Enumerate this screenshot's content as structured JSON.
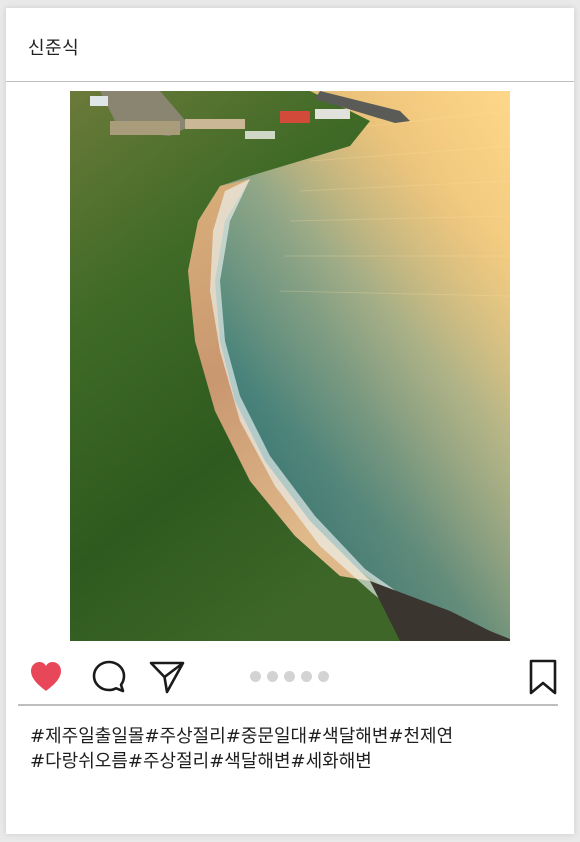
{
  "post": {
    "username": "신준식",
    "liked": true,
    "carousel_count": 5,
    "hashtags": [
      "#제주일출일몰#주상절리#중문일대#색달해변#천제연",
      "#다랑쉬오름#주상절리#색달해변#세화해변"
    ]
  },
  "icons": {
    "like": "heart-icon",
    "comment": "comment-icon",
    "share": "share-icon",
    "save": "bookmark-icon"
  },
  "colors": {
    "heart": "#e8475a",
    "icon_stroke": "#1a1a1a",
    "dot": "#d3d3d3",
    "divider": "#bdbdbd"
  }
}
